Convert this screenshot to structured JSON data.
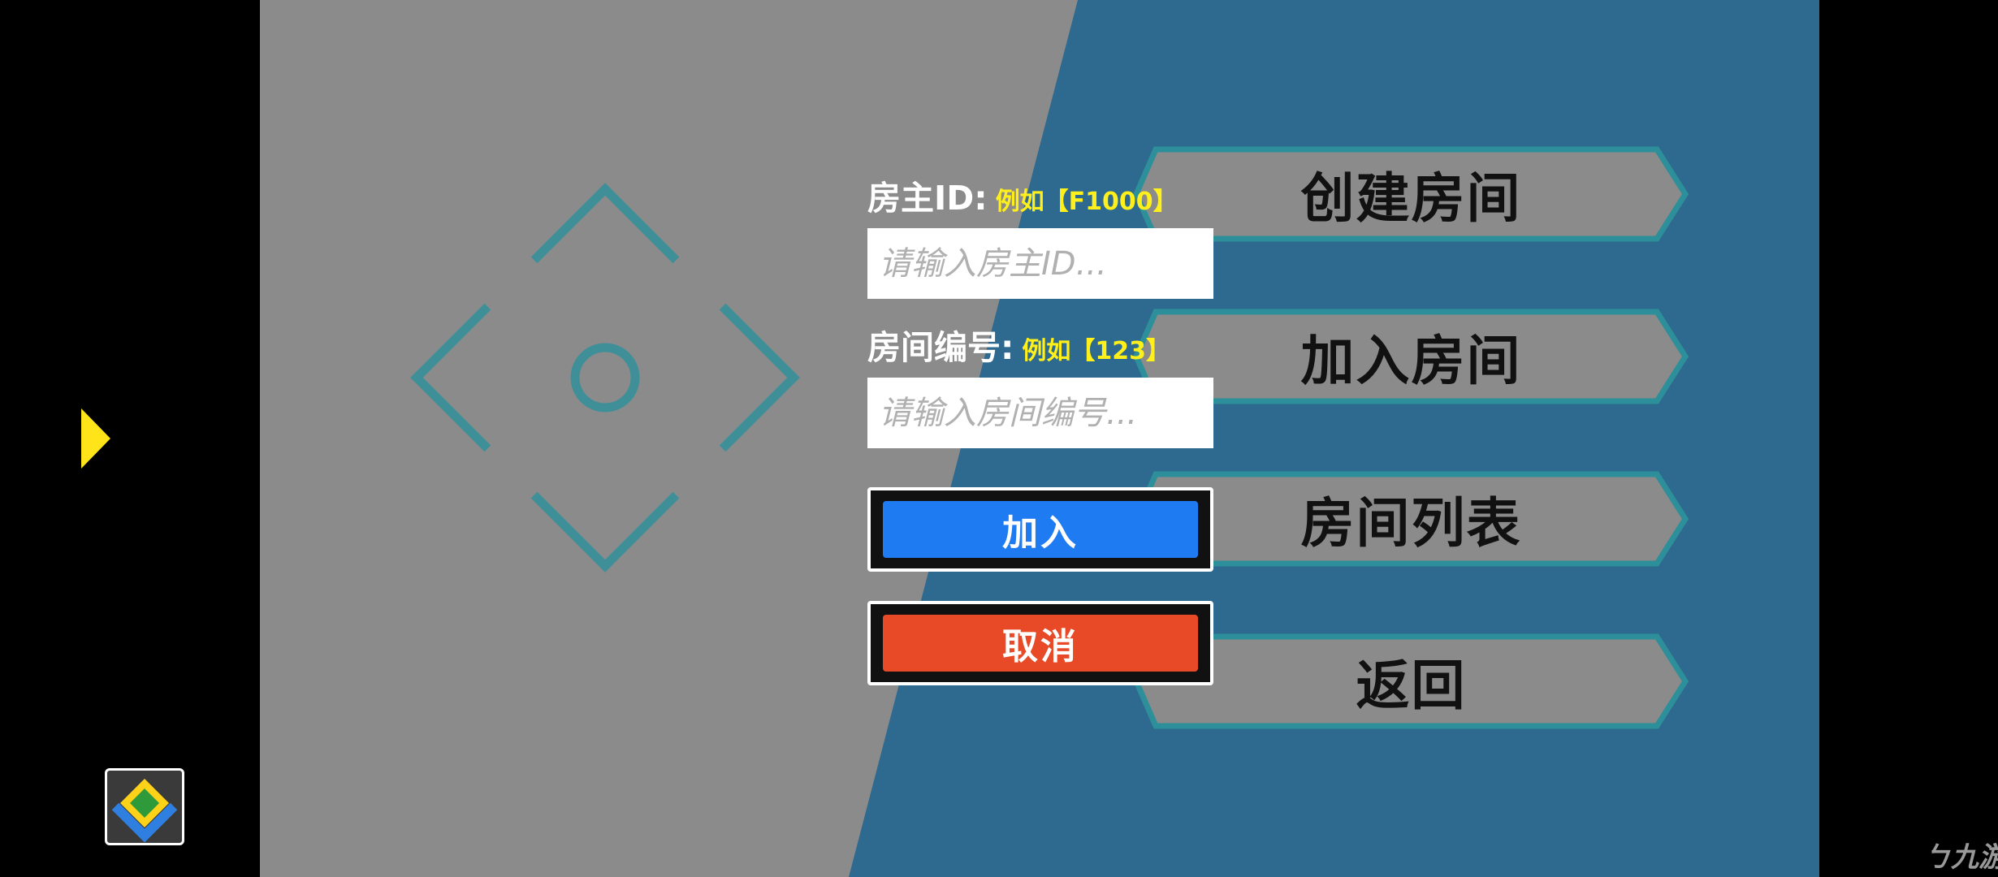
{
  "menu": {
    "items": [
      {
        "label": "创建房间"
      },
      {
        "label": "加入房间"
      },
      {
        "label": "房间列表"
      },
      {
        "label": "返回"
      }
    ]
  },
  "join_form": {
    "host_id_label": "房主ID:",
    "host_id_hint": "例如【F1000】",
    "host_id_placeholder": "请输入房主ID...",
    "room_number_label": "房间编号:",
    "room_number_hint": "例如【123】",
    "room_number_placeholder": "请输入房间编号...",
    "join_label": "加入",
    "cancel_label": "取消"
  },
  "overlay": {
    "watermark_text": "九游"
  },
  "icons": {
    "side_arrow": "play-triangle-icon",
    "app_icon": "chevron-diamond-app-icon",
    "decoration": "crosshair-diamond-icon"
  },
  "colors": {
    "gray_panel": "#8b8b8b",
    "blue_panel": "#2e6a8f",
    "join_button": "#1e7bf2",
    "cancel_button": "#e84a27",
    "hint_yellow": "#ffef1a",
    "menu_button_fill": "#8b8b8b",
    "menu_button_border": "#2d8f99"
  }
}
